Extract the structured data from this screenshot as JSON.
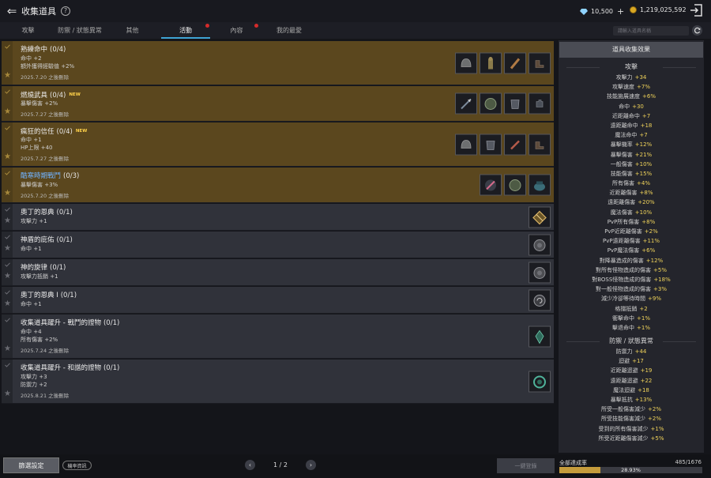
{
  "header": {
    "title": "收集道具",
    "gems": "10,500",
    "coins": "1,219,025,592"
  },
  "tabs": [
    {
      "label": "攻擊",
      "active": false,
      "dot": false
    },
    {
      "label": "防禦 / 狀態異常",
      "active": false,
      "dot": false
    },
    {
      "label": "其他",
      "active": false,
      "dot": false
    },
    {
      "label": "活動",
      "active": true,
      "dot": true
    },
    {
      "label": "內容",
      "active": false,
      "dot": true
    },
    {
      "label": "我的最愛",
      "active": false,
      "dot": false
    }
  ],
  "search": {
    "placeholder": "請輸入道具名稱"
  },
  "collections": [
    {
      "name": "熟練命中",
      "count": "(0/4)",
      "new": "",
      "highlight": true,
      "blue": false,
      "stats": [
        "命中 +2",
        "額外獲得經驗值 +2%"
      ],
      "expire": "2025.7.20 之後刪除",
      "items": [
        "helmet-icon",
        "statue-icon",
        "club-icon",
        "boots-icon"
      ]
    },
    {
      "name": "燃燒武具",
      "count": "(0/4)",
      "new": "NEW",
      "highlight": true,
      "blue": false,
      "stats": [
        "暴擊傷害 +2%"
      ],
      "expire": "2025.7.27 之後刪除",
      "items": [
        "spear-icon",
        "shield-icon",
        "armor-icon",
        "gloves-icon"
      ]
    },
    {
      "name": "瘋狂的信任",
      "count": "(0/4)",
      "new": "NEW",
      "highlight": true,
      "blue": false,
      "stats": [
        "命中 +1",
        "HP上限 +40"
      ],
      "expire": "2025.7.27 之後刪除",
      "items": [
        "helmet-icon",
        "armor-icon",
        "sword-icon",
        "boots-icon"
      ]
    },
    {
      "name": "酷寒時期戰鬥",
      "count": "(0/3)",
      "new": "",
      "highlight": true,
      "blue": true,
      "stats": [
        "暴擊傷害 +3%"
      ],
      "expire": "2025.7.20 之後刪除",
      "items": [
        "staff-icon",
        "shield-icon",
        "pot-icon"
      ]
    },
    {
      "name": "奧丁的恩典",
      "count": "(0/1)",
      "new": "",
      "highlight": false,
      "blue": false,
      "stats": [
        "攻擊力 +1"
      ],
      "expire": "",
      "items": [
        "rune-icon"
      ]
    },
    {
      "name": "神盾的庇佑",
      "count": "(0/1)",
      "new": "",
      "highlight": false,
      "blue": false,
      "stats": [
        "命中 +1"
      ],
      "expire": "",
      "items": [
        "orb-icon"
      ]
    },
    {
      "name": "神的旋律",
      "count": "(0/1)",
      "new": "",
      "highlight": false,
      "blue": false,
      "stats": [
        "攻擊力抵銷 +1"
      ],
      "expire": "",
      "items": [
        "orb-icon"
      ]
    },
    {
      "name": "奧丁的恩典 Ⅰ",
      "count": "(0/1)",
      "new": "",
      "highlight": false,
      "blue": false,
      "stats": [
        "命中 +1"
      ],
      "expire": "",
      "items": [
        "seal-icon"
      ]
    },
    {
      "name": "收集道具躍升 - 戰鬥的證物",
      "count": "(0/1)",
      "new": "",
      "highlight": false,
      "blue": false,
      "stats": [
        "命中 +4",
        "所有傷害 +2%"
      ],
      "expire": "2025.7.24 之後刪除",
      "items": [
        "crystal-icon"
      ]
    },
    {
      "name": "收集道具躍升 - 和諧的證物",
      "count": "(0/1)",
      "new": "",
      "highlight": false,
      "blue": false,
      "stats": [
        "攻擊力 +3",
        "防禦力 +2"
      ],
      "expire": "2025.8.21 之後刪除",
      "items": [
        "ring-icon"
      ]
    }
  ],
  "effects": {
    "header": "道具收集效果",
    "sections": [
      {
        "title": "攻擊",
        "items": [
          {
            "label": "攻擊力",
            "value": "+34"
          },
          {
            "label": "攻擊速度",
            "value": "+7%"
          },
          {
            "label": "技能施展速度",
            "value": "+6%"
          },
          {
            "label": "命中",
            "value": "+30"
          },
          {
            "label": "近距離命中",
            "value": "+7"
          },
          {
            "label": "遠距離命中",
            "value": "+18"
          },
          {
            "label": "魔法命中",
            "value": "+7"
          },
          {
            "label": "暴擊機率",
            "value": "+12%"
          },
          {
            "label": "暴擊傷害",
            "value": "+21%"
          },
          {
            "label": "一般傷害",
            "value": "+10%"
          },
          {
            "label": "技能傷害",
            "value": "+15%"
          },
          {
            "label": "所有傷害",
            "value": "+4%"
          },
          {
            "label": "近距離傷害",
            "value": "+8%"
          },
          {
            "label": "遠距離傷害",
            "value": "+20%"
          },
          {
            "label": "魔法傷害",
            "value": "+10%"
          },
          {
            "label": "PvP所有傷害",
            "value": "+8%"
          },
          {
            "label": "PvP近距離傷害",
            "value": "+2%"
          },
          {
            "label": "PvP遠距離傷害",
            "value": "+11%"
          },
          {
            "label": "PvP魔法傷害",
            "value": "+6%"
          },
          {
            "label": "對降暴造成的傷害",
            "value": "+12%"
          },
          {
            "label": "對所有怪物造成的傷害",
            "value": "+5%"
          },
          {
            "label": "對BOSS怪物造成的傷害",
            "value": "+18%"
          },
          {
            "label": "對一般怪物造成的傷害",
            "value": "+3%"
          },
          {
            "label": "減少冷卻等待時間",
            "value": "+9%"
          },
          {
            "label": "格擋抵銷",
            "value": "+2"
          },
          {
            "label": "衝擊命中",
            "value": "+1%"
          },
          {
            "label": "擊退命中",
            "value": "+1%"
          }
        ]
      },
      {
        "title": "防禦 / 狀態異常",
        "items": [
          {
            "label": "防禦力",
            "value": "+44"
          },
          {
            "label": "迴避",
            "value": "+17"
          },
          {
            "label": "近距離迴避",
            "value": "+19"
          },
          {
            "label": "遠距離迴避",
            "value": "+22"
          },
          {
            "label": "魔法迴避",
            "value": "+18"
          },
          {
            "label": "暴擊抵抗",
            "value": "+13%"
          },
          {
            "label": "所受一般傷害減少",
            "value": "+2%"
          },
          {
            "label": "所受技能傷害減少",
            "value": "+2%"
          },
          {
            "label": "受到的所有傷害減少",
            "value": "+1%"
          },
          {
            "label": "所受近距離傷害減少",
            "value": "+5%"
          }
        ]
      }
    ]
  },
  "footer": {
    "filter": "篩選設定",
    "prob": "機率資訊",
    "page": "1 / 2",
    "register": "一鍵登錄",
    "rate_label": "全部達成率",
    "rate_count": "485/1676",
    "rate_pct": "28.93%",
    "rate_fraction": 0.2893
  },
  "colors": {
    "accent": "#3fa4d4",
    "highlight_row": "#5b471e",
    "value": "#f0d35a",
    "new": "#ffd24a"
  }
}
